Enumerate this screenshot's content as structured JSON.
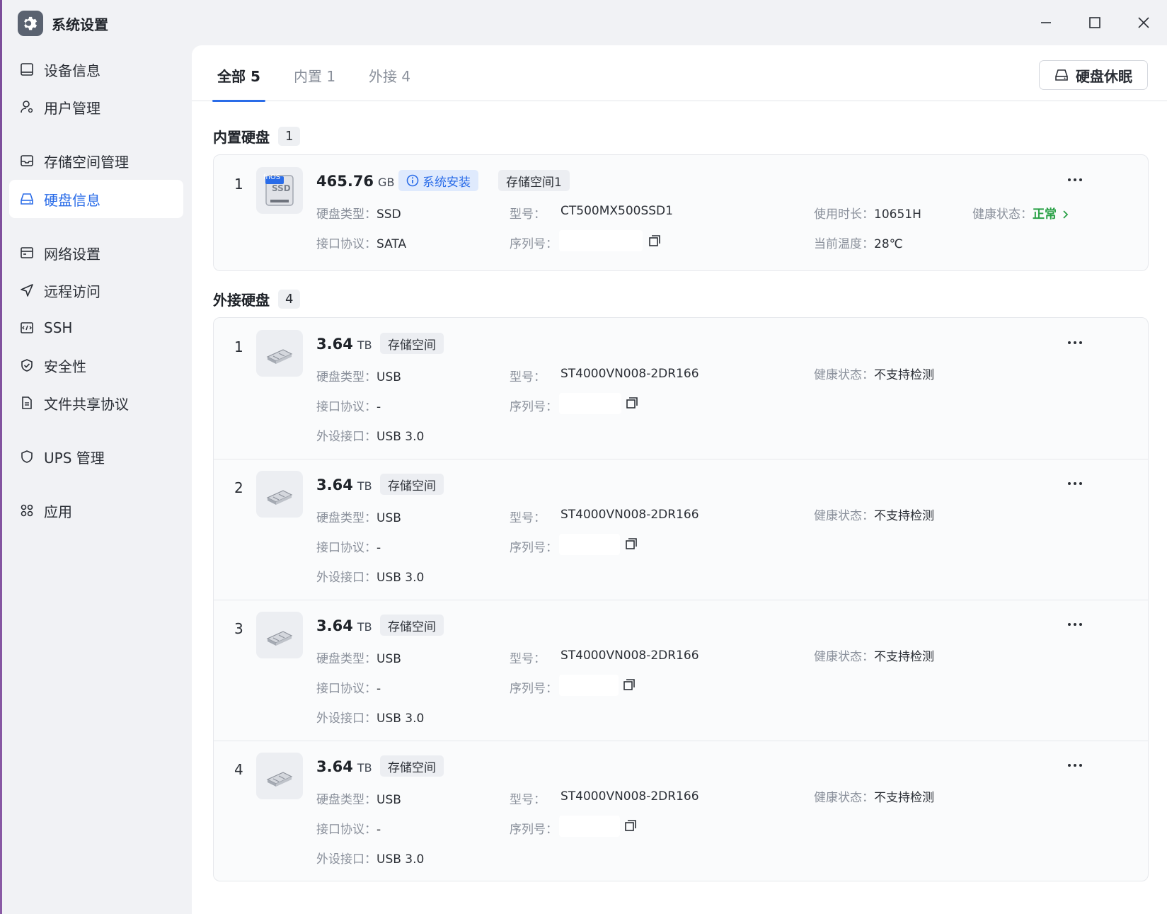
{
  "window": {
    "title": "系统设置"
  },
  "sidebar": {
    "items": [
      {
        "label": "设备信息",
        "icon": "device-icon"
      },
      {
        "label": "用户管理",
        "icon": "user-icon"
      },
      {
        "label": "存储空间管理",
        "icon": "storage-icon"
      },
      {
        "label": "硬盘信息",
        "icon": "disk-icon",
        "active": true
      },
      {
        "label": "网络设置",
        "icon": "network-icon"
      },
      {
        "label": "远程访问",
        "icon": "send-icon"
      },
      {
        "label": "SSH",
        "icon": "terminal-icon"
      },
      {
        "label": "安全性",
        "icon": "shield-icon"
      },
      {
        "label": "文件共享协议",
        "icon": "file-icon"
      },
      {
        "label": "UPS 管理",
        "icon": "ups-shield-icon"
      },
      {
        "label": "应用",
        "icon": "apps-icon"
      }
    ]
  },
  "tabs": [
    {
      "label": "全部 5",
      "active": true
    },
    {
      "label": "内置 1"
    },
    {
      "label": "外接 4"
    }
  ],
  "toolbar": {
    "sleep_label": "硬盘休眠"
  },
  "labels": {
    "disk_type": "硬盘类型：",
    "model": "型号：",
    "protocol": "接口协议：",
    "serial": "序列号：",
    "usage": "使用时长：",
    "health": "健康状态：",
    "temp": "当前温度：",
    "ext_port": "外设接口："
  },
  "internal": {
    "title": "内置硬盘",
    "count": "1",
    "disks": [
      {
        "index": "1",
        "capacity": "465.76",
        "unit": "GB",
        "tag_system": "系统安装",
        "tag_pool": "存储空间1",
        "thumb_badge": "fnOS",
        "thumb_label": "SSD",
        "type": "SSD",
        "model": "CT500MX500SSD1",
        "usage": "10651H",
        "health": "正常",
        "protocol": "SATA",
        "temp": "28℃"
      }
    ]
  },
  "external": {
    "title": "外接硬盘",
    "count": "4",
    "disks": [
      {
        "index": "1",
        "capacity": "3.64",
        "unit": "TB",
        "tag": "存储空间",
        "type": "USB",
        "model": "ST4000VN008-2DR166",
        "health": "不支持检测",
        "protocol": "-",
        "port": "USB 3.0"
      },
      {
        "index": "2",
        "capacity": "3.64",
        "unit": "TB",
        "tag": "存储空间",
        "type": "USB",
        "model": "ST4000VN008-2DR166",
        "health": "不支持检测",
        "protocol": "-",
        "port": "USB 3.0"
      },
      {
        "index": "3",
        "capacity": "3.64",
        "unit": "TB",
        "tag": "存储空间",
        "type": "USB",
        "model": "ST4000VN008-2DR166",
        "health": "不支持检测",
        "protocol": "-",
        "port": "USB 3.0"
      },
      {
        "index": "4",
        "capacity": "3.64",
        "unit": "TB",
        "tag": "存储空间",
        "type": "USB",
        "model": "ST4000VN008-2DR166",
        "health": "不支持检测",
        "protocol": "-",
        "port": "USB 3.0"
      }
    ]
  },
  "colors": {
    "accent": "#2a6ce8",
    "ok": "#2aa147"
  }
}
